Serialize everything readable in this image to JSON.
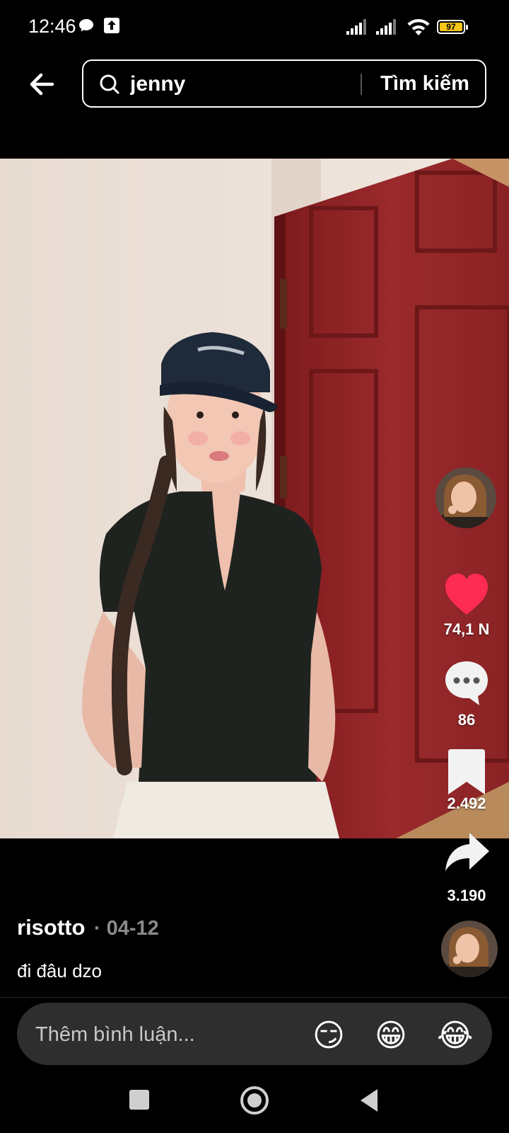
{
  "status_bar": {
    "time": "12:46",
    "battery": "97",
    "icons": [
      "chat-bubble-icon",
      "upload-icon",
      "signal-icon",
      "signal-icon",
      "wifi-icon",
      "battery-icon"
    ]
  },
  "search": {
    "back_icon": "back-arrow-icon",
    "query": "jenny",
    "submit_label": "Tìm kiếm"
  },
  "actions": {
    "likes": "74,1 N",
    "comments": "86",
    "saves": "2.492",
    "shares": "3.190"
  },
  "post": {
    "author": "risotto",
    "date": "· 04-12",
    "caption": "đi đâu dzo"
  },
  "comment_bar": {
    "placeholder": "Thêm bình luận...",
    "emojis": [
      "😏",
      "😁",
      "😂"
    ]
  },
  "colors": {
    "like": "#fe2c55",
    "background": "#000000",
    "comment_bar": "#2e2e2e"
  }
}
